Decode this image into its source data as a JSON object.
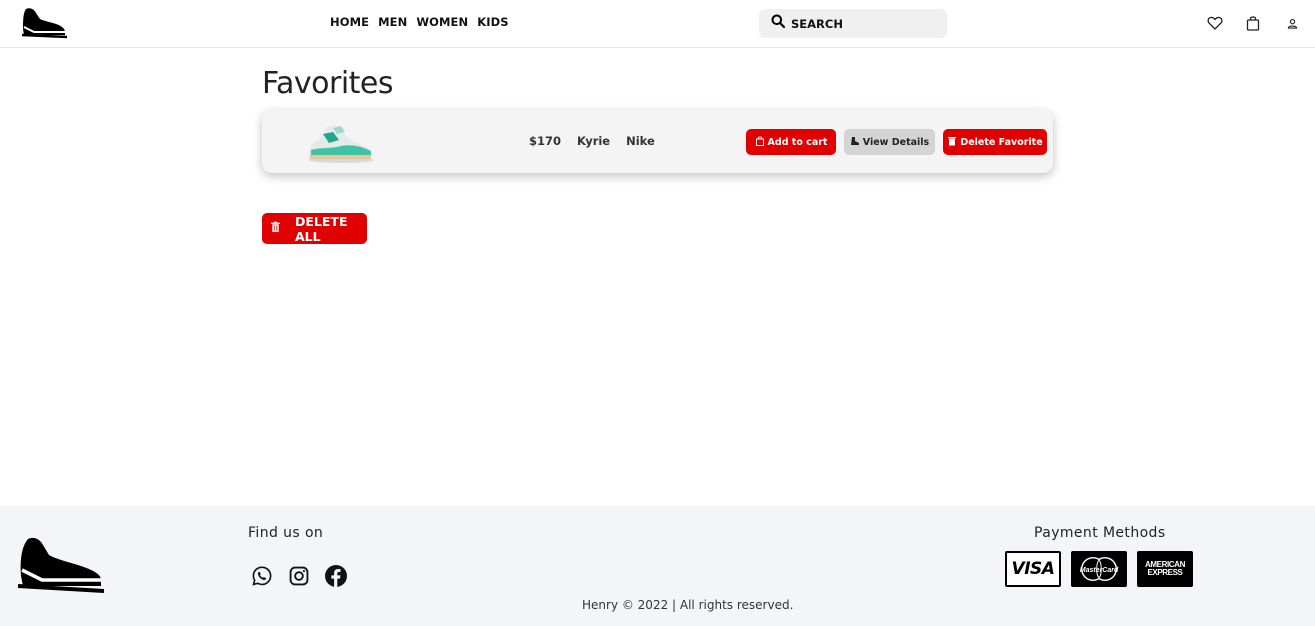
{
  "header": {
    "nav": [
      "HOME",
      "MEN",
      "WOMEN",
      "KIDS"
    ],
    "search_placeholder": "SEARCH",
    "icons": [
      "heart-icon",
      "bag-icon",
      "user-icon"
    ]
  },
  "main": {
    "title": "Favorites",
    "favorites": [
      {
        "price": "$170",
        "model": "Kyrie",
        "brand": "Nike",
        "add_to_cart": "Add to cart",
        "view_details": "View Details",
        "delete_favorite": "Delete Favorite"
      }
    ],
    "delete_all": "DELETE ALL"
  },
  "footer": {
    "find_us": "Find us on",
    "socials": [
      "whatsapp-icon",
      "instagram-icon",
      "facebook-icon"
    ],
    "payment_title": "Payment Methods",
    "payment_cards": {
      "visa": "VISA",
      "mastercard": "MasterCard",
      "amex_line1": "AMERICAN",
      "amex_line2": "EXPRESS"
    },
    "copyright": "Henry © 2022 | All rights reserved."
  },
  "colors": {
    "accent_red": "#e00000",
    "gray_button": "#d4d4d4",
    "footer_bg": "#f4f5f7"
  }
}
